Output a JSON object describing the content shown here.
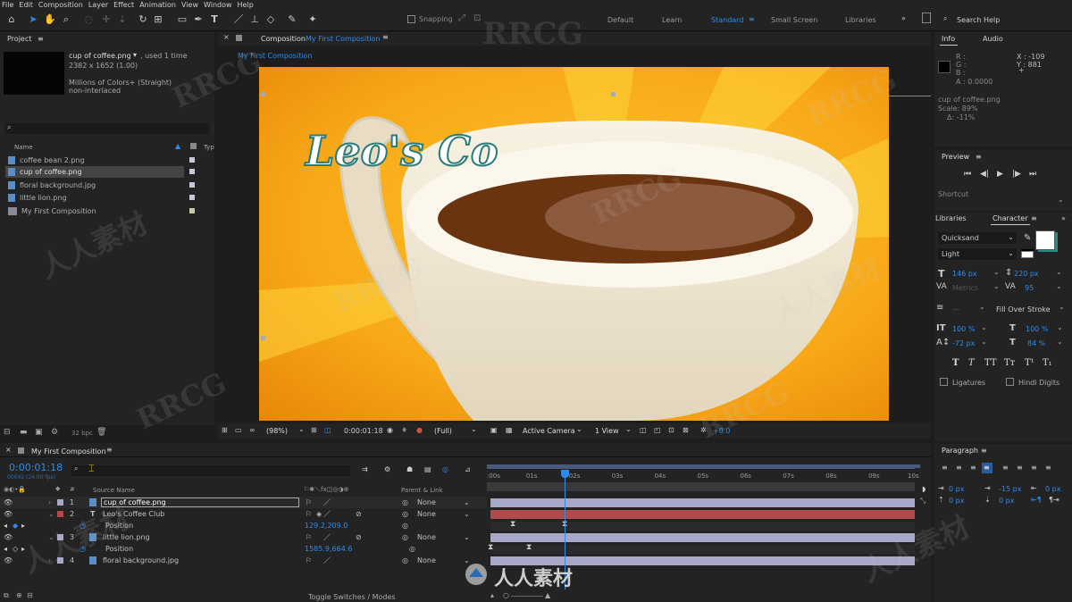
{
  "menu": [
    "File",
    "Edit",
    "Composition",
    "Layer",
    "Effect",
    "Animation",
    "View",
    "Window",
    "Help"
  ],
  "toolbar": {
    "snapping_label": "Snapping"
  },
  "workspaces": [
    "Default",
    "Learn",
    "Standard",
    "Small Screen",
    "Libraries"
  ],
  "search_help": "Search Help",
  "project": {
    "tab": "Project",
    "selected_name": "cup of coffee.png",
    "used": ", used 1 time",
    "dims": "2382 x 1652 (1.00)",
    "color": "Millions of Colors+ (Straight)",
    "interlace": "non-interlaced",
    "col_name": "Name",
    "col_type": "Typ",
    "items": [
      "coffee bean 2.png",
      "cup of coffee.png",
      "floral background.jpg",
      "little lion.png",
      "My First Composition"
    ],
    "bpc": "32 bpc"
  },
  "composition": {
    "tab_prefix": "Composition",
    "tab_name": "My First Composition",
    "breadcrumb": "My First Composition",
    "zoom": "(98%)",
    "time": "0:00:01:18",
    "resolution": "(Full)",
    "camera": "Active Camera",
    "views": "1 View",
    "exposure": "+0.0",
    "canvas_text": "Leo's Co"
  },
  "info": {
    "tab_info": "Info",
    "tab_audio": "Audio",
    "r": "R :",
    "g": "G :",
    "b": "B :",
    "a": "A :  0.0000",
    "x": "X : -109",
    "y": "Y : 881",
    "file": "cup of coffee.png",
    "scale": "Scale: 89%",
    "delta": "Δ: -11%"
  },
  "preview": {
    "tab": "Preview"
  },
  "shortcut": "Shortcut",
  "character": {
    "tab_lib": "Libraries",
    "tab_char": "Character",
    "font": "Quicksand",
    "style": "Light",
    "size": "146 px",
    "leading": "220 px",
    "kerning": "Metrics",
    "tracking": "95",
    "stroke_mode": "Fill Over Stroke",
    "vscale": "100 %",
    "hscale": "100 %",
    "baseline": "-72 px",
    "tsume": "84 %",
    "ligatures": "Ligatures",
    "hindi": "Hindi Digits",
    "fill_color": "#ffffff",
    "stroke_color": "#2a8a8a"
  },
  "paragraph": {
    "tab": "Paragraph",
    "v1": "0 px",
    "v2": "-15 px",
    "v3": "0 px",
    "v4": "0 px",
    "v5": "0 px"
  },
  "timeline": {
    "tab": "My First Composition",
    "time": "0:00:01:18",
    "frames": "00042 (24.00 fps)",
    "col_source": "Source Name",
    "col_parent": "Parent & Link",
    "toggle": "Toggle Switches / Modes",
    "ticks": [
      ":00s",
      "01s",
      "02s",
      "03s",
      "04s",
      "05s",
      "06s",
      "07s",
      "08s",
      "09s",
      "10s"
    ],
    "layers": [
      {
        "num": "1",
        "name": "cup of coffee.png",
        "parent": "None",
        "color": "#a7a7c8"
      },
      {
        "num": "2",
        "name": "Leo's Coffee Club",
        "parent": "None",
        "color": "#b14a4a"
      },
      {
        "num": "",
        "name": "Position",
        "value": "129.2,209.0"
      },
      {
        "num": "3",
        "name": "little lion.png",
        "parent": "None",
        "color": "#a7a7c8"
      },
      {
        "num": "",
        "name": "Position",
        "value": "1585.9,664.6"
      },
      {
        "num": "4",
        "name": "floral background.jpg",
        "parent": "None",
        "color": "#a7a7c8"
      }
    ]
  },
  "watermarks": [
    "RRCG",
    "人人素材"
  ],
  "logo_text": "人人素材"
}
